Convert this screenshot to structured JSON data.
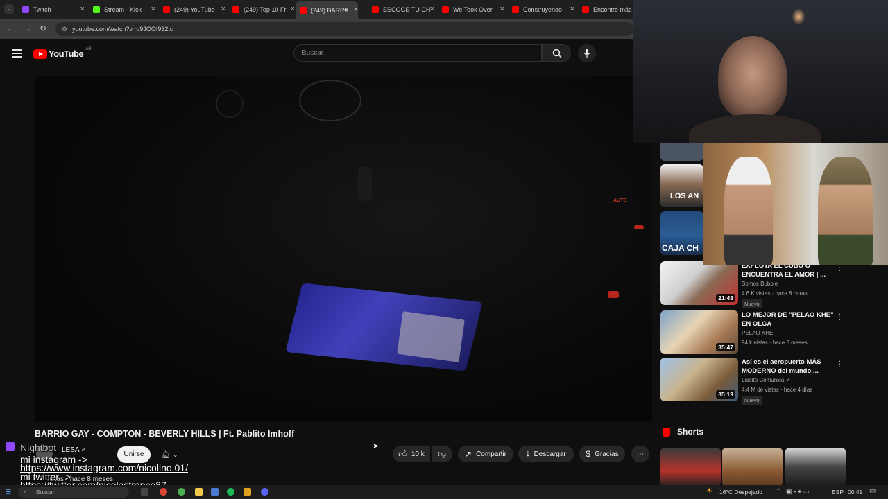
{
  "browser": {
    "tabs": [
      {
        "label": "Twitch",
        "color": "#9146ff"
      },
      {
        "label": "Stream - Kick |",
        "color": "#53fc18"
      },
      {
        "label": "(249) YouTube",
        "color": "#ff0000"
      },
      {
        "label": "(249) Top 10 Fr",
        "color": "#ff0000"
      },
      {
        "label": "(249) BARR",
        "color": "#ff0000"
      },
      {
        "label": "ESCOGE TU CH",
        "color": "#ff0000"
      },
      {
        "label": "We Took Over",
        "color": "#ff0000"
      },
      {
        "label": "Construyendo",
        "color": "#ff0000"
      },
      {
        "label": "Encontré más c",
        "color": "#ff0000"
      }
    ],
    "url": "youtube.com/watch?v=u9JOOI932tc"
  },
  "header": {
    "logo_text": "YouTube",
    "country_code": "AR",
    "search_placeholder": "Buscar"
  },
  "video": {
    "overlay_label": "AUTO",
    "title": "BARRIO GAY - COMPTON - BEVERLY HILLS | Ft. Pablito Imhoff",
    "channel": "LESA",
    "join_label": "Unirse",
    "likes": "10 k",
    "share_label": "Compartir",
    "download_label": "Descargar",
    "thanks_label": "Gracias",
    "meta_views": "7 vistas · hace 8 meses"
  },
  "chat_overlay": {
    "bot_name": "Nightbot",
    "lines": [
      "mi instagram ->",
      "https://www.instagram.com/nicolino.01/",
      "mi twitter ->",
      "https://twitter.com/nicolasfranco87"
    ]
  },
  "sidebar": {
    "recommendations": [
      {
        "title": "EXPLOTA EL CUBO O ENCUENTRA EL AMOR | ...",
        "channel": "Somos Bubble",
        "views": "4.6 K vistas · hace 8 horas",
        "duration": "21:48",
        "badge": "Nuevo",
        "verified": false
      },
      {
        "title": "LO MEJOR DE \"PELAO KHE\" EN OLGA",
        "channel": "PELAO KHE",
        "views": "94 k vistas · hace 3 meses",
        "duration": "35:47",
        "badge": "",
        "verified": false
      },
      {
        "title": "Así es el aeropuerto MÁS MODERNO del mundo ...",
        "channel": "Luisito Comunica",
        "views": "4.4 M de vistas · hace 4 días",
        "duration": "35:19",
        "badge": "Nuevo",
        "verified": true
      }
    ],
    "thumb_texts": [
      "LOS AN",
      "CAJA CH"
    ],
    "shorts_label": "Shorts"
  },
  "taskbar": {
    "search_placeholder": "Buscar",
    "weather": "16°C  Despejado",
    "language": "ESP",
    "time": "00:41"
  }
}
